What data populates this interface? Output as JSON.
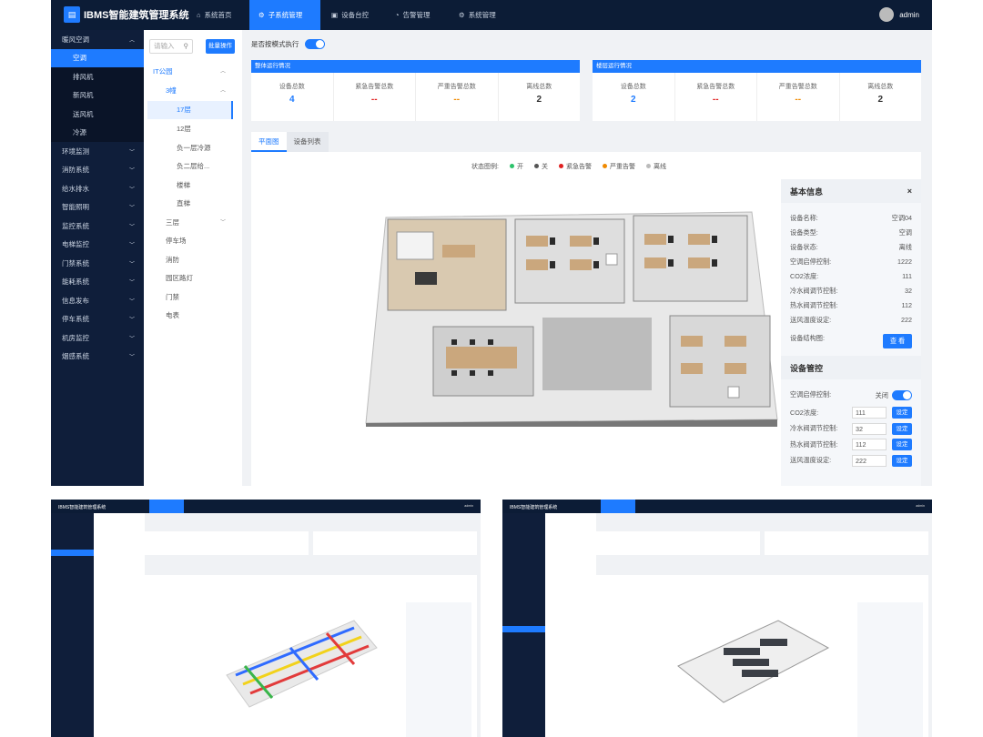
{
  "app": {
    "title": "IBMS智能建筑管理系统",
    "logo_glyph": "▤"
  },
  "nav": [
    {
      "label": "系统首页",
      "icon": "⌂"
    },
    {
      "label": "子系统管理",
      "icon": "⚙"
    },
    {
      "label": "设备台控",
      "icon": "▣"
    },
    {
      "label": "告警管理",
      "icon": "◔"
    },
    {
      "label": "系统管理",
      "icon": "⚙"
    }
  ],
  "user": {
    "name": "admin"
  },
  "sidebar": {
    "groups": [
      {
        "label": "暖风空调",
        "expanded": true,
        "subs": [
          "空调",
          "排风机",
          "新风机",
          "送风机",
          "冷源"
        ],
        "active_sub": "空调"
      },
      {
        "label": "环境监测"
      },
      {
        "label": "消防系统"
      },
      {
        "label": "给水排水"
      },
      {
        "label": "智能照明"
      },
      {
        "label": "监控系统"
      },
      {
        "label": "电梯监控"
      },
      {
        "label": "门禁系统"
      },
      {
        "label": "能耗系统"
      },
      {
        "label": "信息发布"
      },
      {
        "label": "停车系统"
      },
      {
        "label": "机房监控"
      },
      {
        "label": "烟感系统"
      }
    ]
  },
  "tree": {
    "search_placeholder": "请输入",
    "batch_label": "批量操作",
    "nodes": [
      "IT公园",
      "3幢",
      "17层",
      "12层",
      "负一层冷源",
      "负二层给...",
      "楼梯",
      "直梯",
      "三层",
      "停车场",
      "消防",
      "园区路灯",
      "门禁",
      "电表"
    ]
  },
  "content": {
    "linkage_label": "是否按模式执行",
    "overall": {
      "title": "整体运行情况",
      "stats": [
        {
          "label": "设备总数",
          "value": "4",
          "color": "#1e7bff"
        },
        {
          "label": "紧急告警总数",
          "value": "--",
          "color": "#e02020"
        },
        {
          "label": "严重告警总数",
          "value": "--",
          "color": "#f08a00"
        },
        {
          "label": "离线总数",
          "value": "2",
          "color": "#333333"
        }
      ]
    },
    "floor": {
      "title": "楼层运行情况",
      "stats": [
        {
          "label": "设备总数",
          "value": "2",
          "color": "#1e7bff"
        },
        {
          "label": "紧急告警总数",
          "value": "--",
          "color": "#e02020"
        },
        {
          "label": "严重告警总数",
          "value": "--",
          "color": "#f08a00"
        },
        {
          "label": "离线总数",
          "value": "2",
          "color": "#333333"
        }
      ]
    },
    "tabs": [
      "平面图",
      "设备列表"
    ],
    "legend": {
      "label": "状态图例:",
      "items": [
        {
          "label": "开",
          "color": "#2cc36b"
        },
        {
          "label": "关",
          "color": "#555555"
        },
        {
          "label": "紧急告警",
          "color": "#e02020"
        },
        {
          "label": "严重告警",
          "color": "#f08a00"
        },
        {
          "label": "离线",
          "color": "#bbbbbb"
        }
      ]
    },
    "info": {
      "title": "基本信息",
      "close": "×",
      "fields": [
        {
          "k": "设备名称:",
          "v": "空调04"
        },
        {
          "k": "设备类型:",
          "v": "空调"
        },
        {
          "k": "设备状态:",
          "v": "离线"
        },
        {
          "k": "空调启停控制:",
          "v": "1222"
        },
        {
          "k": "CO2浓度:",
          "v": "111"
        },
        {
          "k": "冷水阀调节控制:",
          "v": "32"
        },
        {
          "k": "热水阀调节控制:",
          "v": "112"
        },
        {
          "k": "送风温度设定:",
          "v": "222"
        }
      ],
      "structure_label": "设备结构图:",
      "view_btn": "查 看",
      "control_title": "设备管控",
      "switch_label": "空调启停控制:",
      "switch_state": "关闭",
      "controls": [
        {
          "k": "CO2浓度:",
          "v": "111",
          "btn": "设定"
        },
        {
          "k": "冷水阀调节控制:",
          "v": "32",
          "btn": "设定"
        },
        {
          "k": "热水阀调节控制:",
          "v": "112",
          "btn": "设定"
        },
        {
          "k": "送风温度设定:",
          "v": "222",
          "btn": "设定"
        }
      ]
    }
  },
  "thumbs": [
    {
      "title": "IBMS智能建筑管理系统",
      "user": "admin"
    },
    {
      "title": "IBMS智能建筑管理系统",
      "user": "admin"
    }
  ]
}
